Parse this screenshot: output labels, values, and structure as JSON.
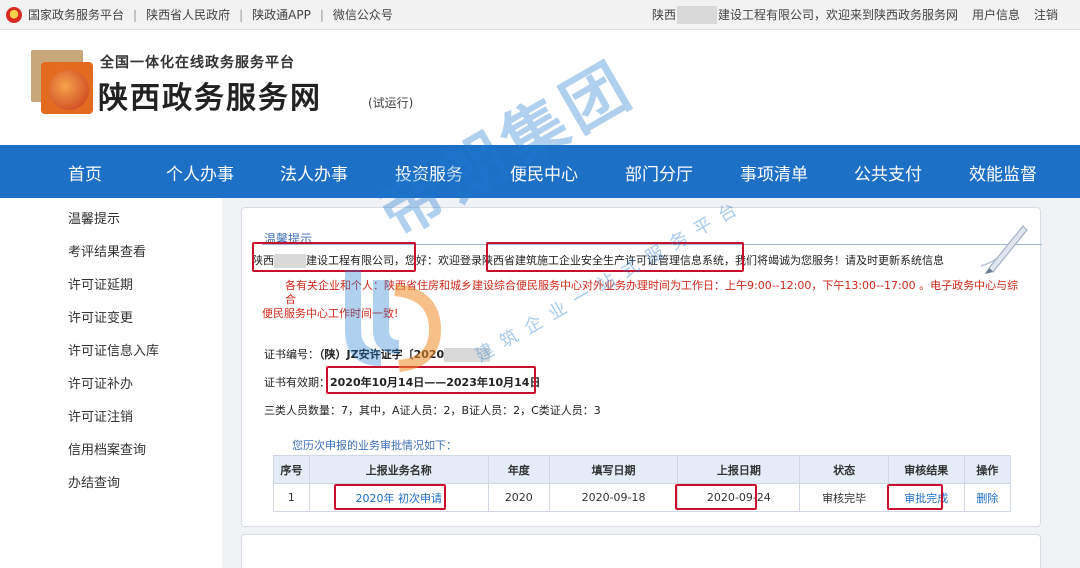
{
  "topbar": {
    "links": [
      "国家政务服务平台",
      "陕西省人民政府",
      "陕政通APP",
      "微信公众号"
    ],
    "welcome_prefix": "陕西",
    "welcome_suffix": "建设工程有限公司，欢迎来到陕西政务服务网",
    "user_info": "用户信息",
    "logout": "注销"
  },
  "header": {
    "subtitle": "全国一体化在线政务服务平台",
    "title": "陕西政务服务网",
    "trial": "(试运行)"
  },
  "nav": [
    "首页",
    "个人办事",
    "法人办事",
    "投资服务",
    "便民中心",
    "部门分厅",
    "事项清单",
    "公共支付",
    "效能监督"
  ],
  "sidebar": [
    "温馨提示",
    "考评结果查看",
    "许可证延期",
    "许可证变更",
    "许可证信息入库",
    "许可证补办",
    "许可证注销",
    "信用档案查询",
    "办结查询"
  ],
  "notice": {
    "title": "温馨提示",
    "greet_prefix": "陕西",
    "greet_company_suffix": "建设工程有限公司",
    "greet_rest": "，您好：欢迎登录陕西省建筑施工企业安全生产许可证管理信息系统，我们将竭诚为您服务！请及时更新系统信息",
    "red_line1": "各有关企业和个人：陕西省住房和城乡建设综合便民服务中心对外业务办理时间为工作日：上午9:00--12:00，下午13:00--17:00 。电子政务中心与综合",
    "red_line2": "便民服务中心工作时间一致!"
  },
  "certificate": {
    "number_label": "证书编号：",
    "number_value": "（陕）JZ安许证字〔2020",
    "validity_label": "证书有效期：",
    "validity_value": "2020年10月14日——2023年10月14日",
    "staff": "三类人员数量：7，其中，A证人员：2，B证人员：2，C类证人员：3"
  },
  "history": {
    "title": "您历次申报的业务审批情况如下：",
    "columns": [
      "序号",
      "上报业务名称",
      "年度",
      "填写日期",
      "上报日期",
      "状态",
      "审核结果",
      "操作"
    ],
    "rows": [
      {
        "index": "1",
        "name": "2020年 初次申请",
        "year": "2020",
        "fill_date": "2020-09-18",
        "report_date": "2020-09-24",
        "status": "审核完毕",
        "result": "审批完成",
        "action": "删除"
      }
    ]
  },
  "watermark": {
    "main": "帝朗集团",
    "sub": "建筑企业一站式服务平台"
  },
  "colors": {
    "nav_blue": "#1e6fc6",
    "highlight_red": "#c8102e",
    "notice_red": "#d0281b"
  }
}
